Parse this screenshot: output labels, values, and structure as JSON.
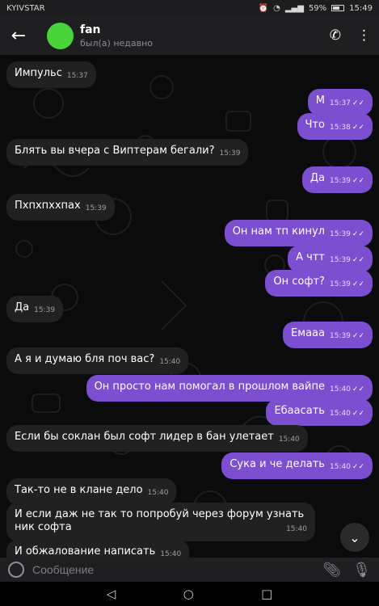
{
  "status_bar": {
    "carrier": "KYIVSTAR",
    "battery": "59%",
    "time": "15:49"
  },
  "header": {
    "title": "fan",
    "subtitle": "был(а) недавно"
  },
  "messages": [
    {
      "dir": "in",
      "text": "Импульс",
      "time": "15:37"
    },
    {
      "dir": "out",
      "text": "М",
      "time": "15:37"
    },
    {
      "dir": "out",
      "text": "Что",
      "time": "15:38"
    },
    {
      "dir": "in",
      "text": "Блять вы вчера с Виптерам бегали?",
      "time": "15:39"
    },
    {
      "dir": "out",
      "text": "Да",
      "time": "15:39"
    },
    {
      "dir": "in",
      "text": "Пхпхпххпах",
      "time": "15:39"
    },
    {
      "dir": "out",
      "text": "Он нам тп кинул",
      "time": "15:39"
    },
    {
      "dir": "out",
      "text": "А чтт",
      "time": "15:39"
    },
    {
      "dir": "out",
      "text": "Он софт?",
      "time": "15:39"
    },
    {
      "dir": "in",
      "text": "Да",
      "time": "15:39"
    },
    {
      "dir": "out",
      "text": "Емааа",
      "time": "15:39"
    },
    {
      "dir": "in",
      "text": "А я и думаю бля поч вас?",
      "time": "15:40"
    },
    {
      "dir": "out",
      "text": "Он просто нам помогал в прошлом вайпе",
      "time": "15:40"
    },
    {
      "dir": "out",
      "text": "Ебаасать",
      "time": "15:40"
    },
    {
      "dir": "in",
      "text": "Если бы соклан был софт лидер в бан улетает",
      "time": "15:40"
    },
    {
      "dir": "out",
      "text": "Сука и че делать",
      "time": "15:40"
    },
    {
      "dir": "in",
      "text": "Так-то не в клане дело",
      "time": "15:40"
    },
    {
      "dir": "in",
      "text": "И если даж не так то попробуй через форум узнать ник софта",
      "time": "15:40"
    },
    {
      "dir": "in",
      "text": "И обжалование написать",
      "time": "15:40"
    }
  ],
  "input": {
    "placeholder": "Сообщение"
  },
  "ticks": "✓✓"
}
